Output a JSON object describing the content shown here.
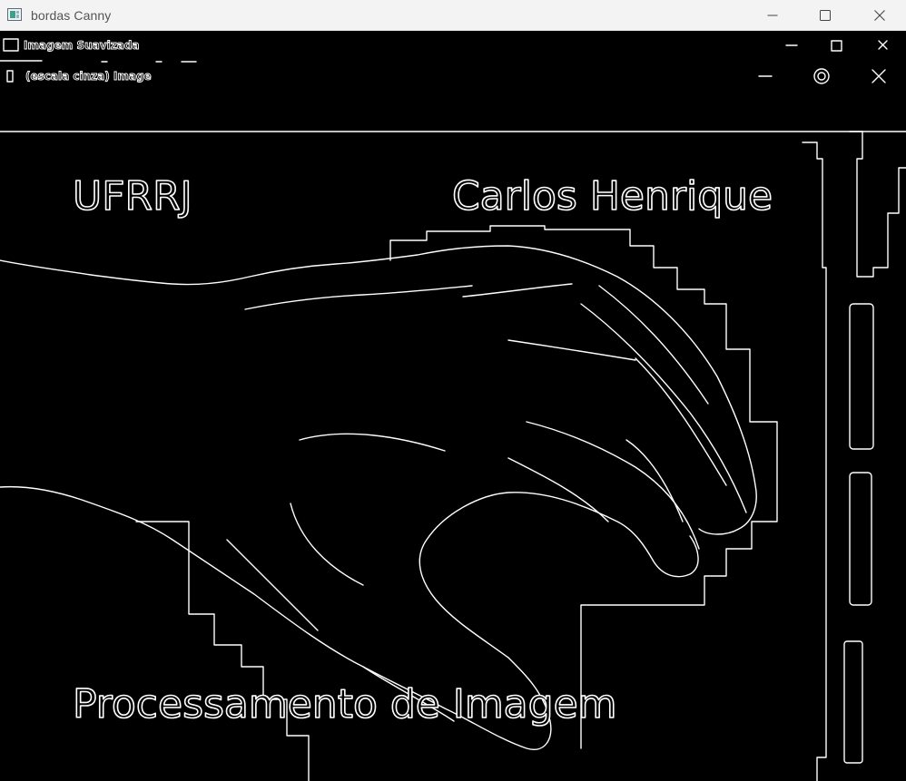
{
  "window": {
    "title": "bordas Canny",
    "icon": "opencv-window-icon"
  },
  "caption_buttons": {
    "minimize": "minimize-icon",
    "maximize": "maximize-icon",
    "close": "close-icon"
  },
  "edge_image": {
    "nested_title_1": "Imagem Suavizada",
    "nested_title_2": "(escala cinza) Image",
    "text_top_left": "UFRRJ",
    "text_top_right": "Carlos Henrique",
    "text_bottom": "Processamento de Imagem",
    "colors": {
      "background": "#000000",
      "edges": "#ffffff"
    }
  }
}
